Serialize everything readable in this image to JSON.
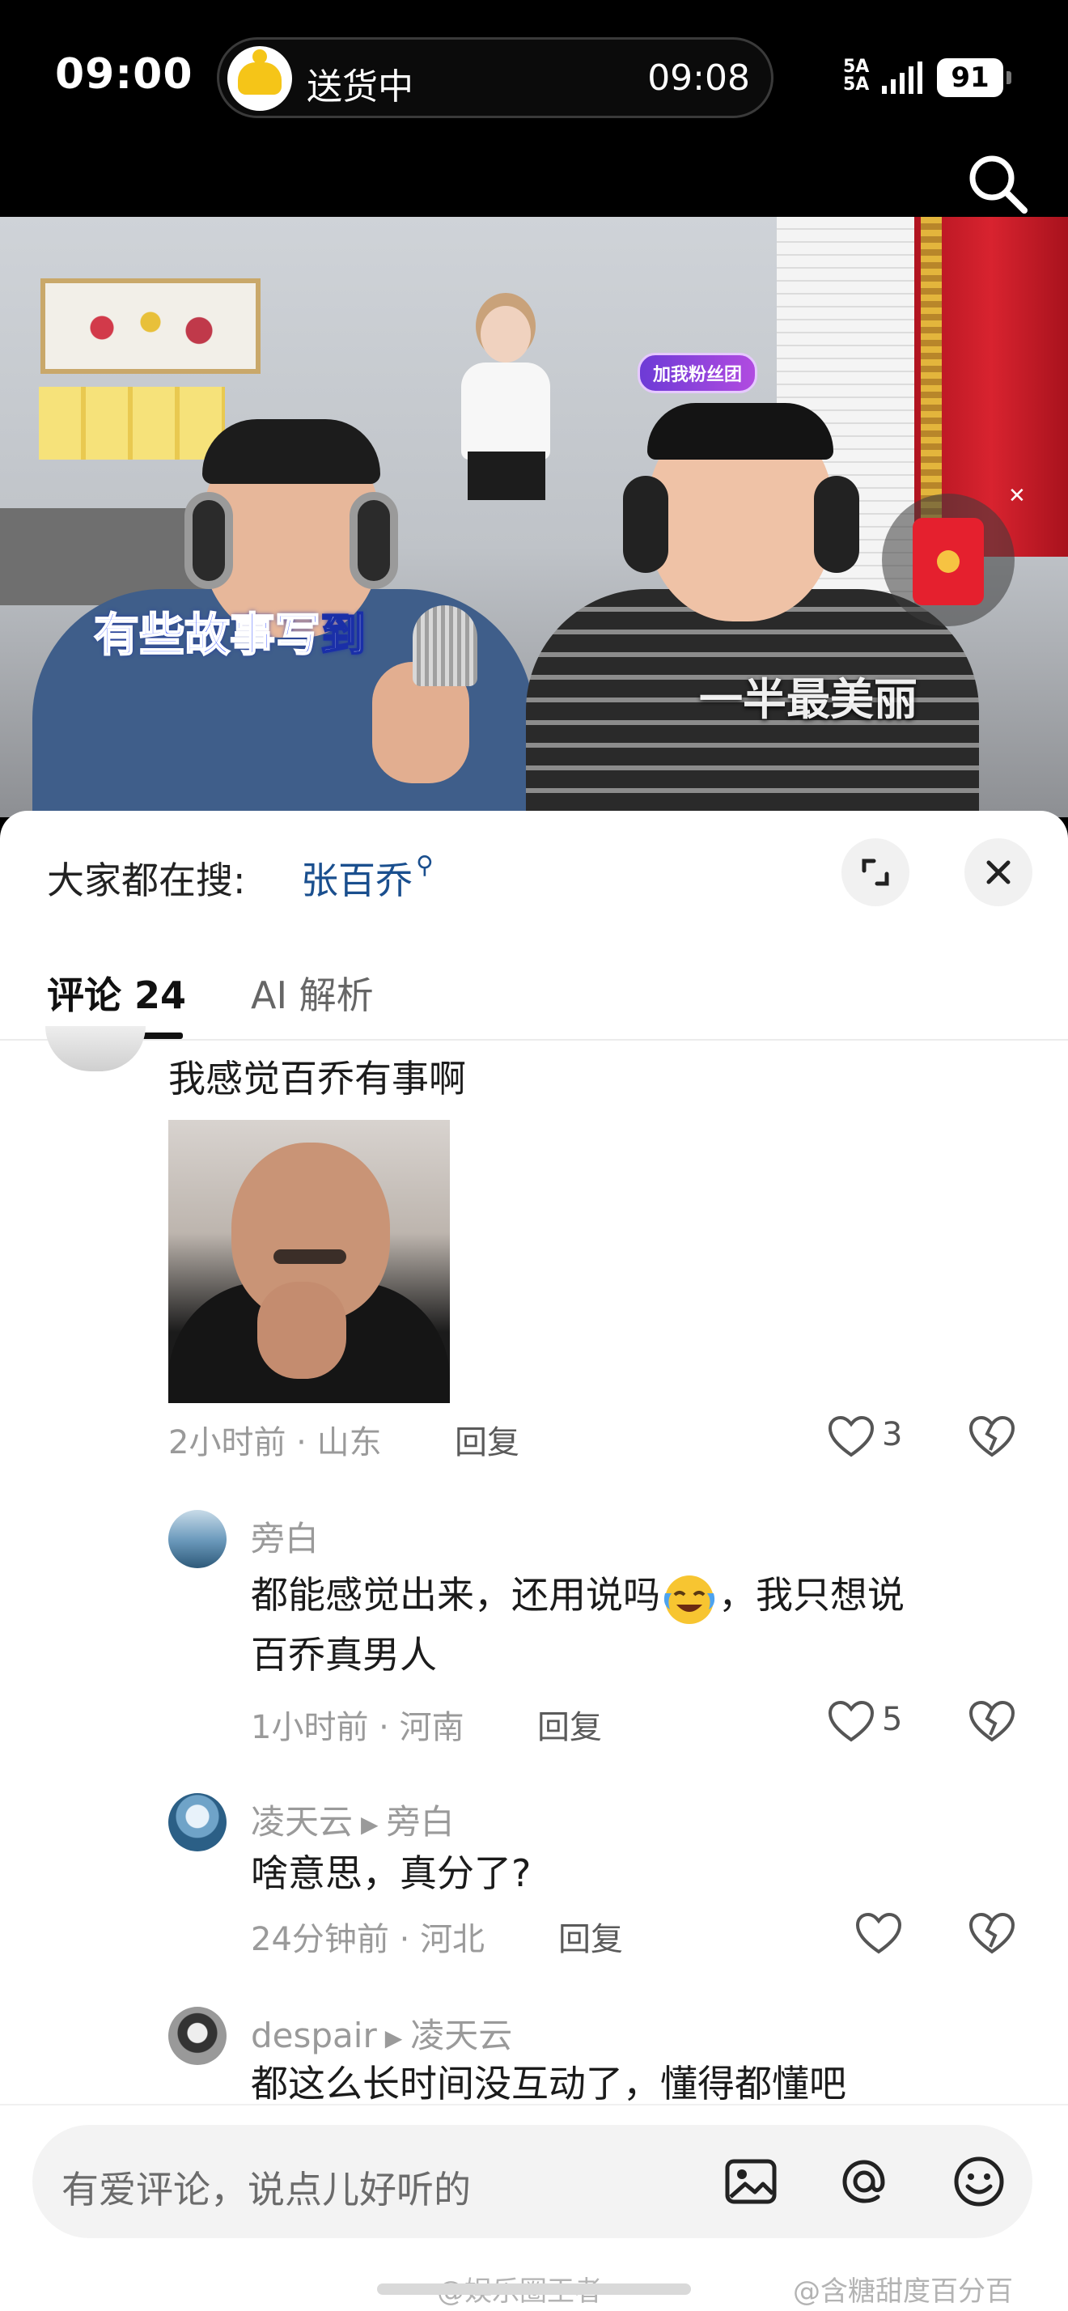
{
  "status_bar": {
    "time": "09:00",
    "live_activity": {
      "label": "送货中",
      "eta": "09:08"
    },
    "network": "5A\n5A",
    "battery": "91"
  },
  "video": {
    "fan_badge": "加我粉丝团",
    "lyric_line_1": {
      "highlighted": "有些故事写",
      "rest": "到"
    },
    "lyric_line_2": "一半最美丽"
  },
  "sheet": {
    "search_prefix": "大家都在搜:",
    "search_term": "张百乔",
    "tabs": [
      {
        "label": "评论 24",
        "active": true
      },
      {
        "label": "AI 解析",
        "active": false
      }
    ]
  },
  "comments": [
    {
      "text": "我感觉百乔有事啊",
      "time": "2小时前",
      "location": "山东",
      "reply_label": "回复",
      "likes": "3"
    },
    {
      "user": "旁白",
      "text_line1": "都能感觉出来，还用说吗",
      "text_line1_after": "，我只想说",
      "text_line2": "百乔真男人",
      "time": "1小时前",
      "location": "河南",
      "reply_label": "回复",
      "likes": "5"
    },
    {
      "user": "凌天云",
      "reply_to": "旁白",
      "text": "啥意思，真分了?",
      "time": "24分钟前",
      "location": "河北",
      "reply_label": "回复",
      "likes": ""
    },
    {
      "user": "despair",
      "reply_to": "凌天云",
      "text": "都这么长时间没互动了，懂得都懂吧"
    }
  ],
  "input": {
    "placeholder": "有爱评论，说点儿好听的"
  },
  "watermarks": [
    "@娱乐圈王者",
    "@含糖甜度百分百"
  ],
  "icons": {
    "search": "search-icon",
    "red_packet": "red-packet-icon",
    "expand": "expand-icon",
    "close": "close-icon",
    "like": "heart-icon",
    "dislike": "broken-heart-icon",
    "image": "image-icon",
    "mention": "at-icon",
    "emoji": "emoji-icon"
  },
  "colors": {
    "search_term": "#1a4f8e",
    "battery_bg": "#ffffff",
    "red_packet": "#e5202e"
  }
}
